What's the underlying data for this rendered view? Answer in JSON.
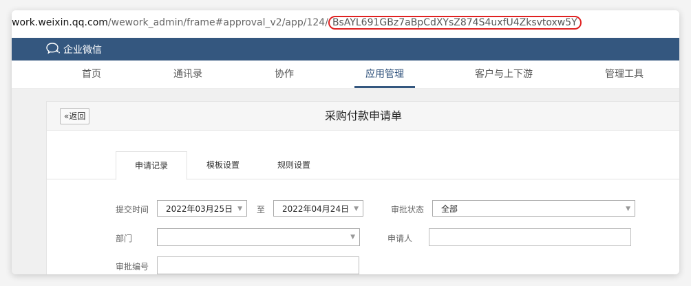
{
  "browser": {
    "url_host": "work.weixin.qq.com",
    "url_path": "/wework_admin/frame#approval_v2/app/124/",
    "url_highlight": "BsAYL691GBz7aBpCdXYsZ874S4uxfU4Zksvtoxw5Y",
    "highlight_color": "#e02020"
  },
  "app": {
    "name": "企业微信",
    "brand_color": "#34577f"
  },
  "nav": {
    "items": [
      "首页",
      "通讯录",
      "协作",
      "应用管理",
      "客户与上下游",
      "管理工具"
    ],
    "active_index": 3
  },
  "panel": {
    "back_label": "返回",
    "title": "采购付款申请单"
  },
  "tabs": {
    "items": [
      "申请记录",
      "模板设置",
      "规则设置"
    ],
    "active_index": 0
  },
  "filters": {
    "submit_time_label": "提交时间",
    "start_date": "2022年03月25日",
    "to_label": "至",
    "end_date": "2022年04月24日",
    "status_label": "审批状态",
    "status_value": "全部",
    "dept_label": "部门",
    "dept_value": "",
    "applicant_label": "申请人",
    "applicant_value": "",
    "approval_no_label": "审批编号",
    "approval_no_value": ""
  }
}
